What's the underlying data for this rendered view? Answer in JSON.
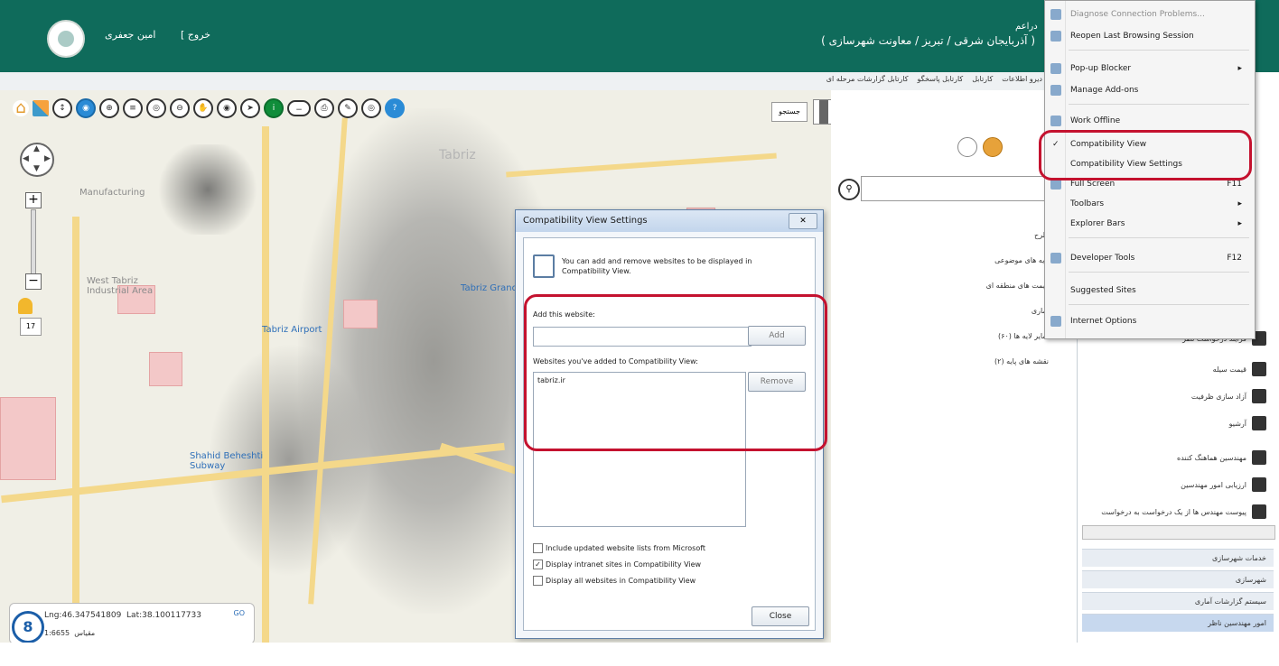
{
  "header": {
    "user_name": "امین جعفری",
    "logout_label": "[ خروج",
    "location_title": "( آذربایجان شرقی / تبریز / معاونت شهرسازی )",
    "org_label": "دراعم"
  },
  "subbar": {
    "links": [
      "دیرو اطلاعات",
      "کارتابل",
      "کارتابل پاسخگو",
      "کارتابل گزارشات مرحله ای"
    ]
  },
  "toolbar": {
    "search_label": "جستجو"
  },
  "map": {
    "labels": {
      "tabriz": "Tabriz",
      "manufacturing": "Manufacturing",
      "west_tabriz": "West Tabriz Industrial Area",
      "airport": "Tabriz Airport",
      "subway1": "Shahid Beheshti Subway",
      "subway2": "Tabriz Grand"
    },
    "zoom_level": "17",
    "coords": {
      "lon_label": "Lng:46.347541809",
      "lat_label": "Lat:38.100117733",
      "scale_label": "1:6655",
      "scale_caption": "مقیاس",
      "go_label": "GO",
      "badge": "8"
    }
  },
  "layers_panel": {
    "items": [
      "طرح",
      "لایه های موضوعی",
      "قیمت های منطقه ای",
      "آماری",
      "سایر لایه ها (۶۰)",
      "نقشه های پایه (۲)"
    ]
  },
  "right_panel": {
    "items": [
      "فرآیند درخواست نظر",
      "قیمت سیله",
      "آزاد سازی ظرفیت",
      "آرشیو",
      "مهندسین هماهنگ کننده",
      "ارزیابی امور مهندسین",
      "پیوست مهندس ها از یک درخواست به درخواست"
    ],
    "tabs": [
      "خدمات شهرسازی",
      "شهرسازی",
      "سیستم گزارشات آماری",
      "امور مهندسین ناظر"
    ]
  },
  "dialog": {
    "title": "Compatibility View Settings",
    "intro": "You can add and remove websites to be displayed in Compatibility View.",
    "add_label": "Add this website:",
    "add_value": "",
    "add_button": "Add",
    "list_label": "Websites you've added to Compatibility View:",
    "list_items": [
      "tabriz.ir"
    ],
    "remove_button": "Remove",
    "checks": [
      {
        "label": "Include updated website lists from Microsoft",
        "checked": false
      },
      {
        "label": "Display intranet sites in Compatibility View",
        "checked": true
      },
      {
        "label": "Display all websites in Compatibility View",
        "checked": false
      }
    ],
    "close_button": "Close"
  },
  "tools_menu": {
    "items": [
      {
        "label": "Diagnose Connection Problems...",
        "shortcut": "",
        "dim": true
      },
      {
        "label": "Reopen Last Browsing Session",
        "shortcut": "",
        "dim": false
      },
      {
        "label": "Pop-up Blocker",
        "shortcut": "▸",
        "dim": false
      },
      {
        "label": "Manage Add-ons",
        "shortcut": "",
        "dim": false
      },
      {
        "label": "Work Offline",
        "shortcut": "",
        "dim": false
      },
      {
        "label": "Compatibility View",
        "shortcut": "",
        "dim": false,
        "checked": true
      },
      {
        "label": "Compatibility View Settings",
        "shortcut": "",
        "dim": false
      },
      {
        "label": "Full Screen",
        "shortcut": "F11",
        "dim": false
      },
      {
        "label": "Toolbars",
        "shortcut": "▸",
        "dim": false
      },
      {
        "label": "Explorer Bars",
        "shortcut": "▸",
        "dim": false
      },
      {
        "label": "Developer Tools",
        "shortcut": "F12",
        "dim": false
      },
      {
        "label": "Suggested Sites",
        "shortcut": "",
        "dim": false
      },
      {
        "label": "Internet Options",
        "shortcut": "",
        "dim": false
      }
    ]
  },
  "colors": {
    "header_bg": "#0f6b5b",
    "highlight_red": "#c4122f",
    "dialog_border": "#5f7fa6"
  }
}
